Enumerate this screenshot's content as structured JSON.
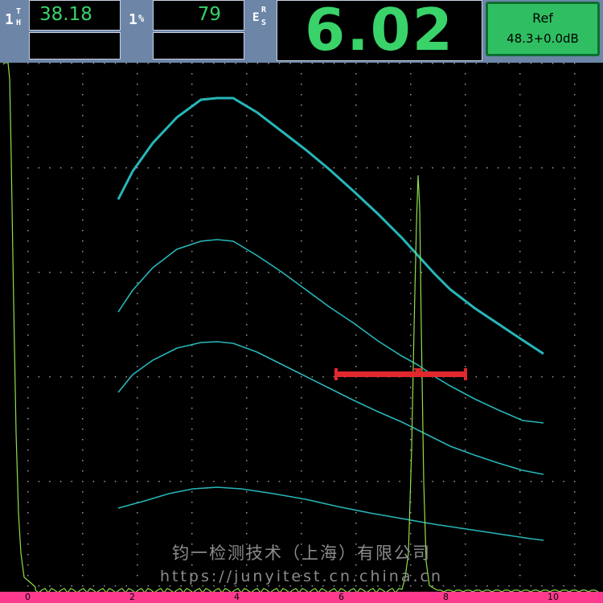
{
  "header": {
    "gate_t": {
      "index": "1",
      "sup": "T",
      "sub": "H",
      "value": "38.18"
    },
    "gate_pct": {
      "index": "1",
      "suffix": "%",
      "value": "79"
    },
    "ers": {
      "e": "E",
      "r": "R",
      "s": "S"
    },
    "big_value": "6.02",
    "ref": {
      "label": "Ref",
      "gain": "48.3+0.0dB"
    }
  },
  "colors": {
    "header_bg": "#6d86a8",
    "readout_green": "#39d36a",
    "ref_bg": "#2fbf62",
    "dac_curve": "#27b6b9",
    "a_scan": "#8fe04b",
    "gate": "#e0282e",
    "axis_bar": "#ff3b8f"
  },
  "axis": {
    "x_min": 0,
    "x_max": 10,
    "tick_labels": [
      "0",
      "2",
      "4",
      "6",
      "8",
      "10"
    ]
  },
  "watermark": {
    "line1": "钧一检测技术（上海）有限公司",
    "line2": "https://junyitest.cn.china.cn"
  }
}
